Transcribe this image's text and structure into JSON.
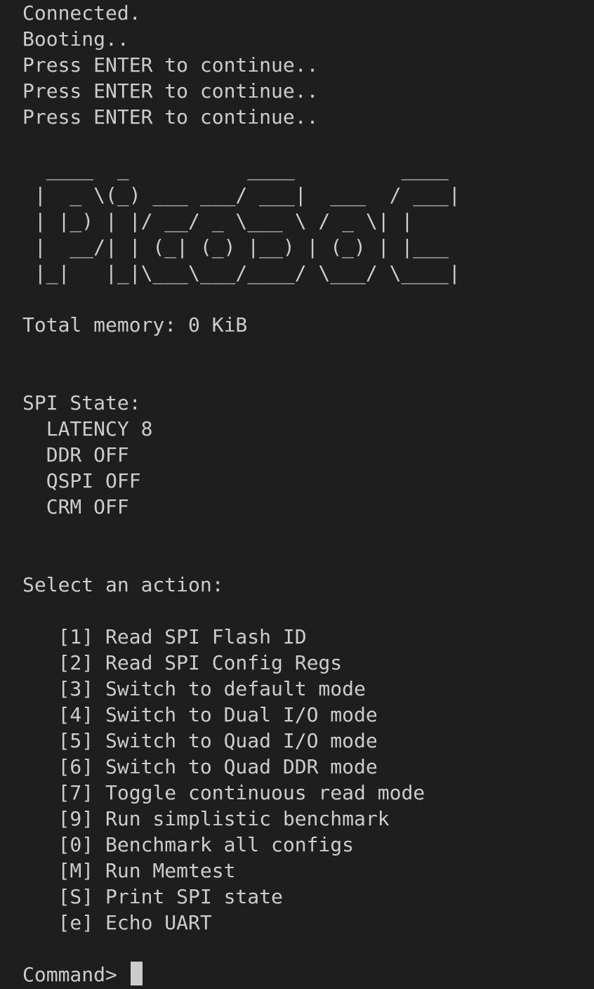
{
  "boot_log": [
    "Connected.",
    "Booting..",
    "Press ENTER to continue..",
    "Press ENTER to continue..",
    "Press ENTER to continue.."
  ],
  "banner": [
    "  ____  _          ____         ____",
    " |  _ \\(_) ___ ___/ ___|  ___  / ___|",
    " | |_) | |/ __/ _ \\___ \\ / _ \\| |",
    " |  __/| | (_| (_) |__) | (_) | |___",
    " |_|   |_|\\___\\___/____/ \\___/ \\____|"
  ],
  "memory_line": "Total memory: 0 KiB",
  "spi_state": {
    "header": "SPI State:",
    "items": [
      "  LATENCY 8",
      "  DDR OFF",
      "  QSPI OFF",
      "  CRM OFF"
    ]
  },
  "menu": {
    "header": "Select an action:",
    "items": [
      "   [1] Read SPI Flash ID",
      "   [2] Read SPI Config Regs",
      "   [3] Switch to default mode",
      "   [4] Switch to Dual I/O mode",
      "   [5] Switch to Quad I/O mode",
      "   [6] Switch to Quad DDR mode",
      "   [7] Toggle continuous read mode",
      "   [9] Run simplistic benchmark",
      "   [0] Benchmark all configs",
      "   [M] Run Memtest",
      "   [S] Print SPI state",
      "   [e] Echo UART"
    ]
  },
  "prompt": "Command> "
}
